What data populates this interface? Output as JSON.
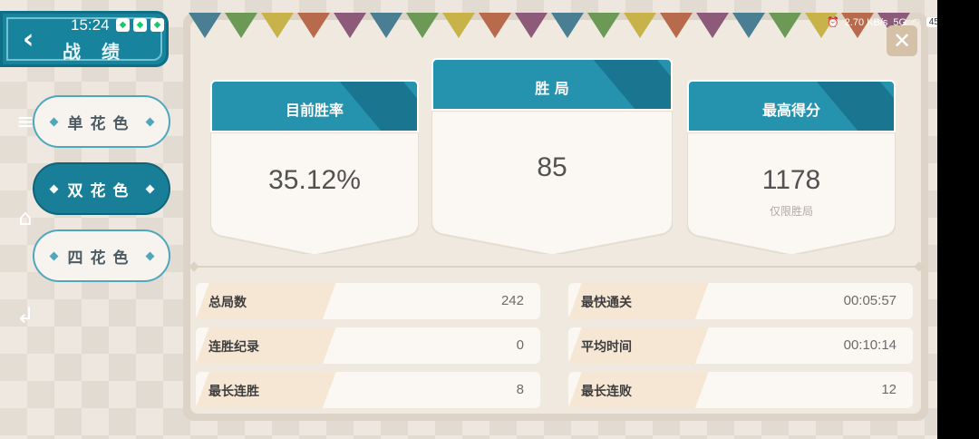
{
  "status_bar": {
    "time": "15:24",
    "net_speed": "2.70 KB/s",
    "network": "5G",
    "battery": "45"
  },
  "header": {
    "title": "战 绩"
  },
  "categories": [
    {
      "label": "单花色",
      "active": false
    },
    {
      "label": "双花色",
      "active": true
    },
    {
      "label": "四花色",
      "active": false
    }
  ],
  "cards": {
    "win_rate": {
      "label": "目前胜率",
      "value": "35.12%"
    },
    "wins": {
      "label": "胜 局",
      "value": "85"
    },
    "high_score": {
      "label": "最高得分",
      "value": "1178",
      "note": "仅限胜局"
    }
  },
  "stats_left": [
    {
      "label": "总局数",
      "value": "242"
    },
    {
      "label": "连胜纪录",
      "value": "0"
    },
    {
      "label": "最长连胜",
      "value": "8"
    }
  ],
  "stats_right": [
    {
      "label": "最快通关",
      "value": "00:05:57"
    },
    {
      "label": "平均时间",
      "value": "00:10:14"
    },
    {
      "label": "最长连败",
      "value": "12"
    }
  ],
  "colors": {
    "accent": "#2693ae",
    "accent_dark": "#17839c"
  }
}
